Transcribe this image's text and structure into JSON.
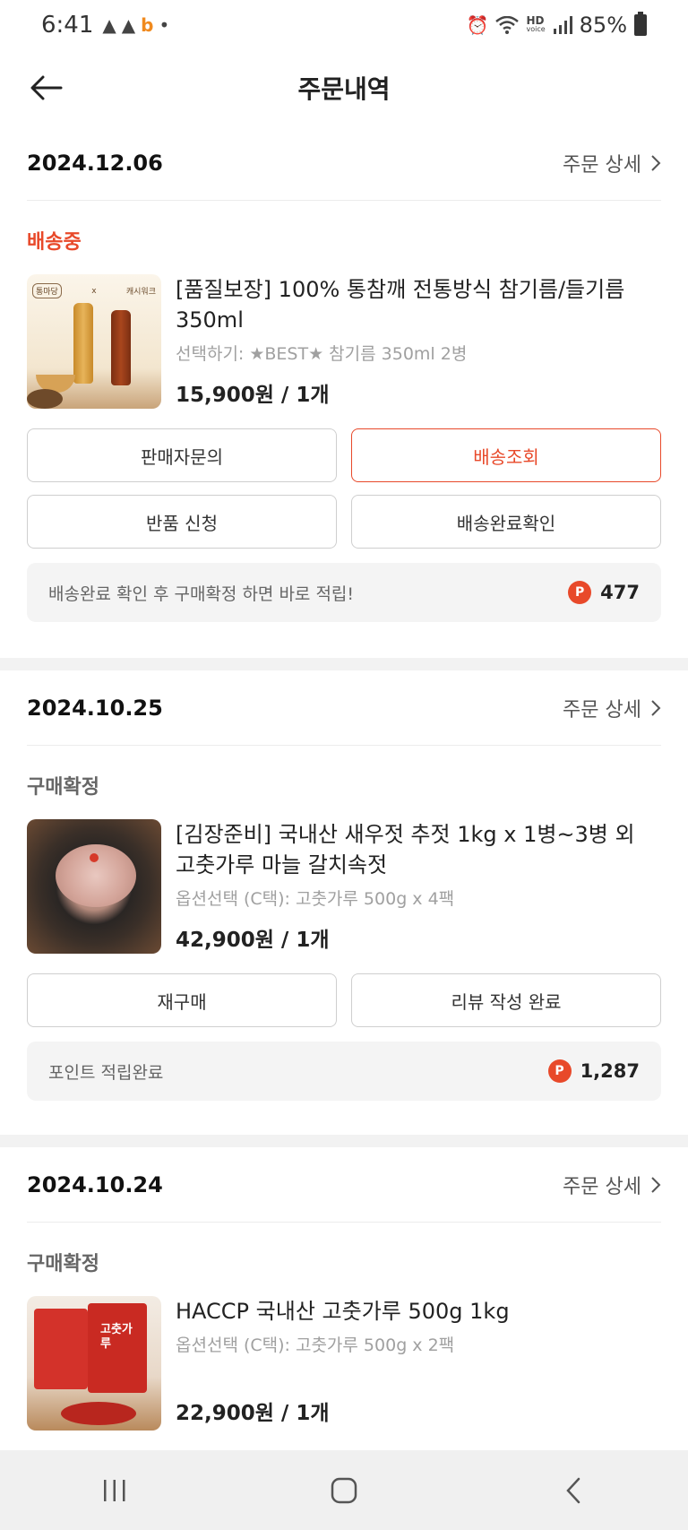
{
  "status_bar": {
    "time": "6:41",
    "battery": "85%",
    "network_label": "HD",
    "network_sub": "voice"
  },
  "header": {
    "title": "주문내역"
  },
  "orders": [
    {
      "date": "2024.12.06",
      "detail_label": "주문 상세",
      "status": "배송중",
      "product": {
        "name": "[품질보장] 100% 통참깨 전통방식 참기름/들기름 350ml",
        "option": "선택하기: ★BEST★ 참기름 350ml 2병",
        "price": "15,900원 / 1개"
      },
      "buttons": [
        "판매자문의",
        "배송조회",
        "반품 신청",
        "배송완료확인"
      ],
      "point_text": "배송완료 확인 후 구매확정 하면 바로 적립!",
      "point_value": "477"
    },
    {
      "date": "2024.10.25",
      "detail_label": "주문 상세",
      "status": "구매확정",
      "product": {
        "name": "[김장준비] 국내산 새우젓 추젓 1kg x 1병~3병 외 고춧가루 마늘 갈치속젓",
        "option": "옵션선택 (C택): 고춧가루 500g x 4팩",
        "price": "42,900원 / 1개"
      },
      "buttons": [
        "재구매",
        "리뷰 작성 완료"
      ],
      "point_text": "포인트 적립완료",
      "point_value": "1,287"
    },
    {
      "date": "2024.10.24",
      "detail_label": "주문 상세",
      "status": "구매확정",
      "product": {
        "name": "HACCP 국내산 고춧가루 500g 1kg",
        "option": "옵션선택 (C택): 고춧가루 500g x 2팩",
        "price": "22,900원 / 1개"
      }
    }
  ],
  "point_badge": "P",
  "thumb_text": {
    "order1_left": "통마당",
    "order1_x": "x",
    "order1_right": "캐시워크",
    "order3": "고춧가루"
  },
  "colors": {
    "accent": "#e8492a",
    "muted": "#a0a0a0",
    "divider": "#f2f2f2"
  }
}
